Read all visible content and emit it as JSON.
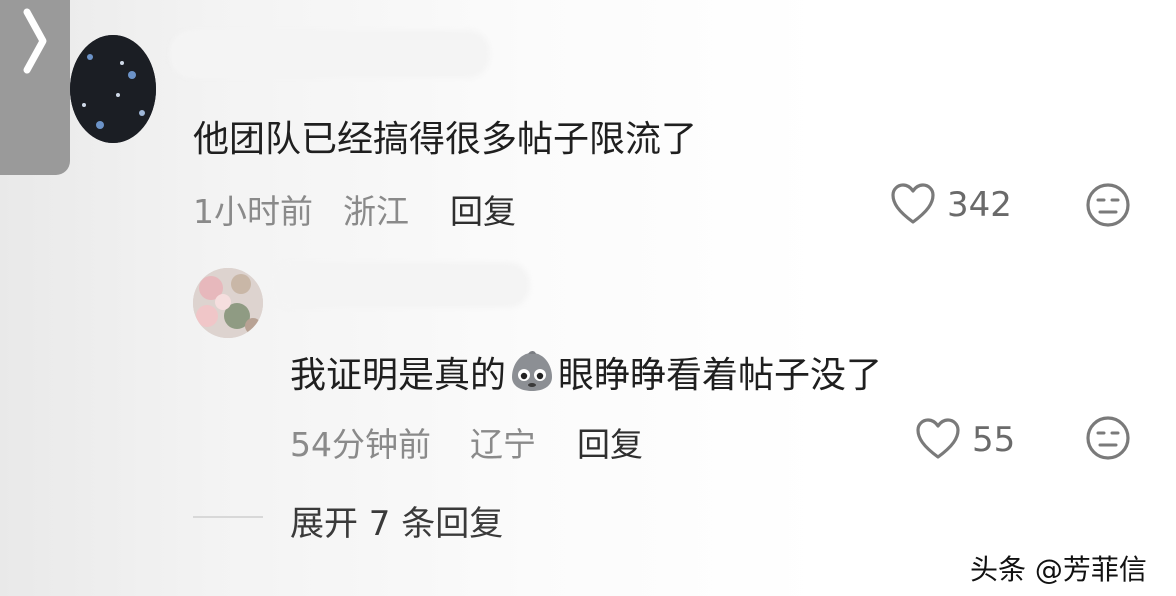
{
  "comments": [
    {
      "text": "他团队已经搞得很多帖子限流了",
      "time": "1小时前",
      "location": "浙江",
      "reply_label": "回复",
      "likes": "342"
    },
    {
      "text_before": "我证明是真的",
      "text_after": "眼睁睁看着帖子没了",
      "inline_emoji": "crying-face-emoji",
      "time": "54分钟前",
      "location": "辽宁",
      "reply_label": "回复",
      "likes": "55"
    }
  ],
  "expand_replies": "展开 7 条回复",
  "watermark": "头条 @芳菲信",
  "icons": {
    "back": "chevron-right-icon",
    "like": "heart-outline-icon",
    "dislike": "neutral-face-icon"
  },
  "colors": {
    "text": "#1f1f1f",
    "meta": "#8a8a8a",
    "icon": "#7a7a7a"
  }
}
